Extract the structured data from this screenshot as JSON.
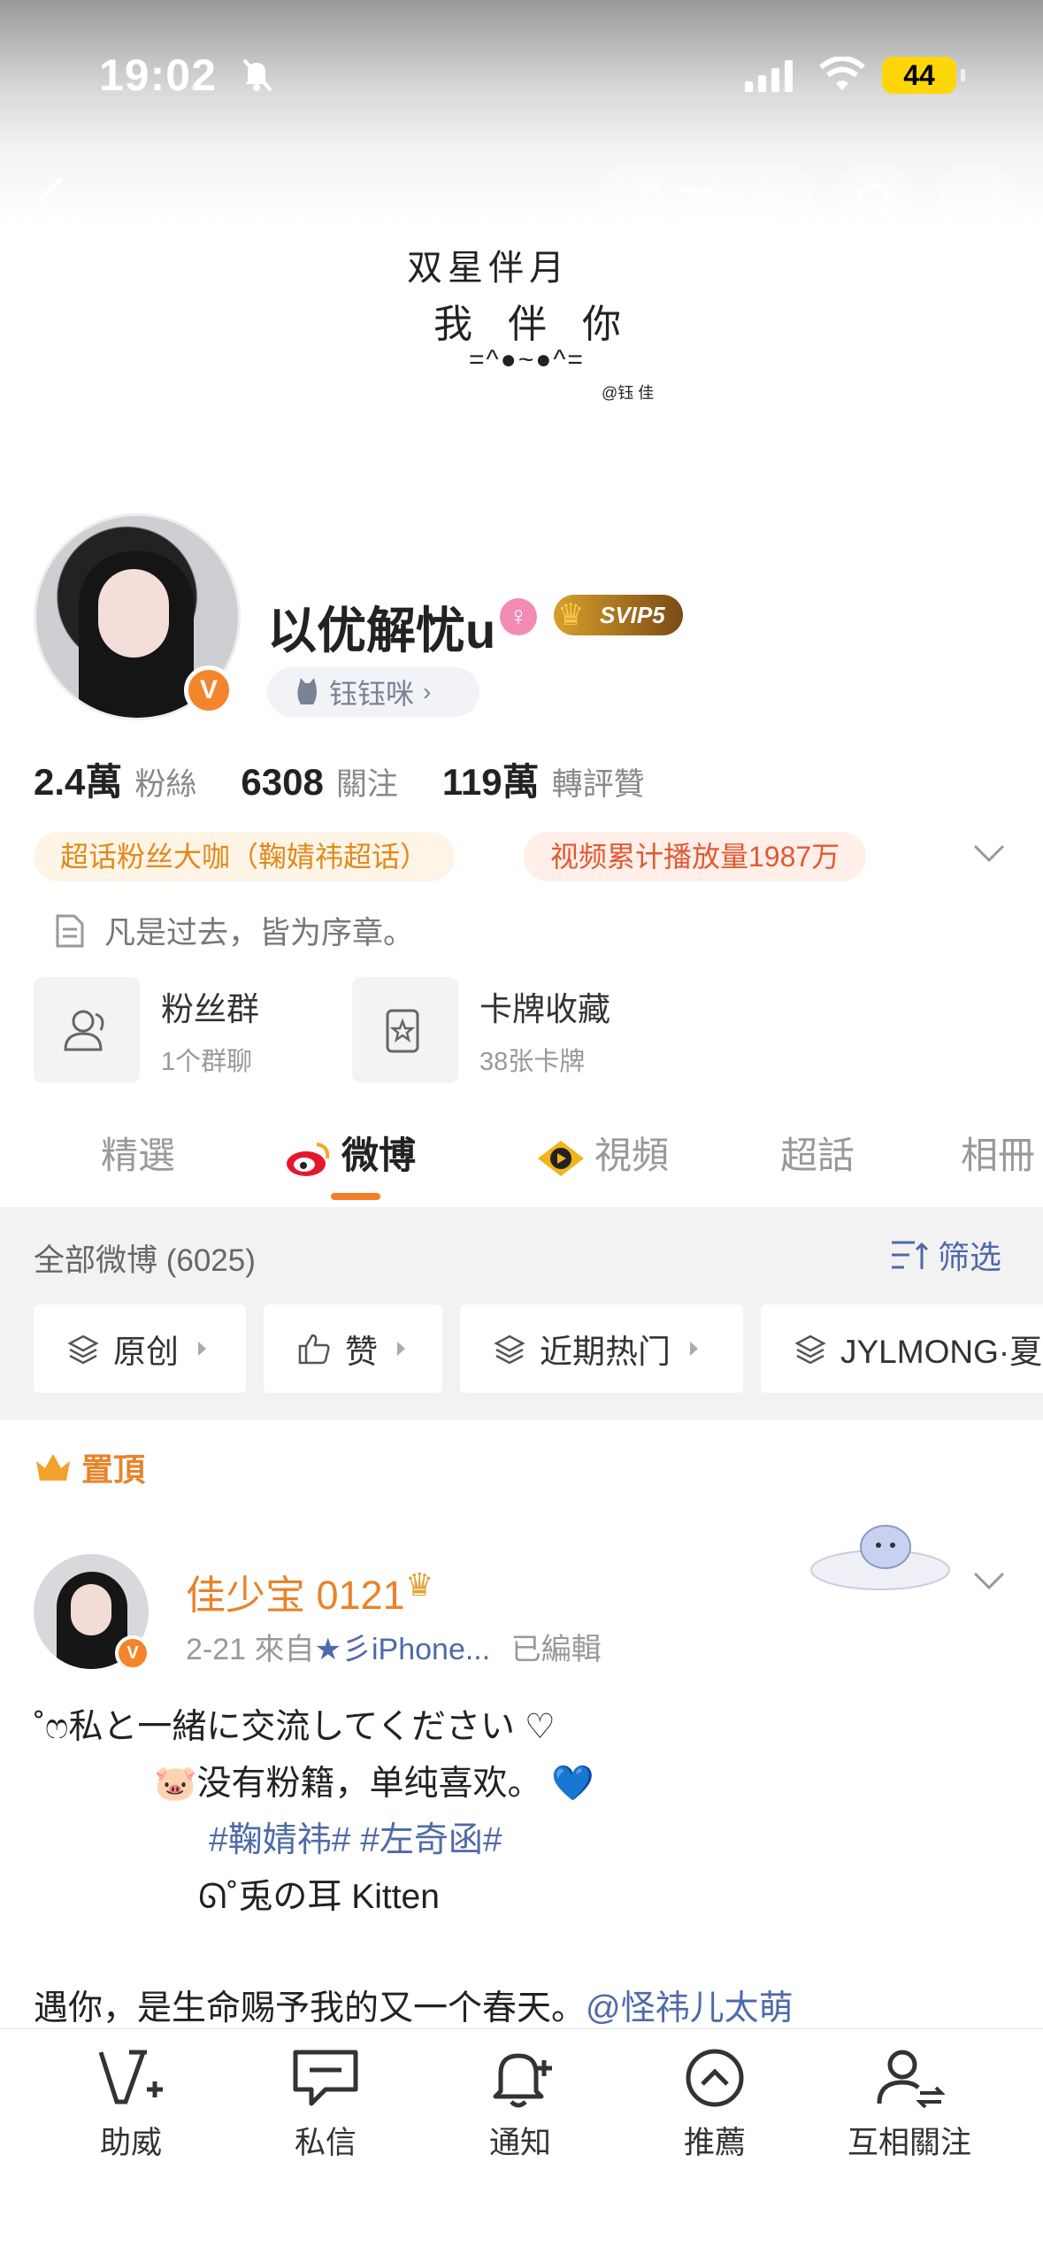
{
  "status_bar": {
    "time": "19:02",
    "battery": "44"
  },
  "header": {
    "like_button": "喜欢你"
  },
  "banner": {
    "line1": "双星伴月",
    "line2": "我伴你",
    "line3": "=^●~●^=",
    "credit": "@钰 佳"
  },
  "profile": {
    "name": "以优解忧u",
    "vip_label": "SVIP5",
    "tag": "钰钰咪",
    "verified_mark": "V",
    "stats": [
      {
        "value": "2.4萬",
        "label": "粉絲"
      },
      {
        "value": "6308",
        "label": "關注"
      },
      {
        "value": "119萬",
        "label": "轉評贊"
      }
    ],
    "chips": [
      "超话粉丝大咖（鞠婧祎超话）",
      "视频累计播放量1987万"
    ],
    "bio": "凡是过去，皆为序章。",
    "cards": [
      {
        "title": "粉丝群",
        "subtitle": "1个群聊"
      },
      {
        "title": "卡牌收藏",
        "subtitle": "38张卡牌"
      }
    ]
  },
  "tabs": [
    "精選",
    "微博",
    "視頻",
    "超話",
    "相冊"
  ],
  "feed": {
    "all_count": "全部微博 (6025)",
    "filter_label": "筛选",
    "pills": [
      "原创",
      "赞",
      "近期热门",
      "JYLMONG·夏"
    ]
  },
  "post": {
    "pinned_label": "置頂",
    "author": "佳少宝 0121",
    "date": "2-21",
    "source_prefix": "來自",
    "source": "★彡iPhone...",
    "edited": "已編輯",
    "line1": "˚ෆ私と一緒に交流してください ♡",
    "line2": "🐷没有粉籍，单纯喜欢。 💙",
    "line3": "#鞠婧祎# #左奇函#",
    "line4": "ᘏ˚兎の耳 Kitten",
    "line5_text": "遇你，是生命赐予我的又一个春天。",
    "line5_mention": "@怪祎儿太萌"
  },
  "bottom_nav": [
    {
      "label": "助威",
      "icon": "v-plus-icon"
    },
    {
      "label": "私信",
      "icon": "chat-icon"
    },
    {
      "label": "通知",
      "icon": "bell-plus-icon"
    },
    {
      "label": "推薦",
      "icon": "up-circle-icon"
    },
    {
      "label": "互相關注",
      "icon": "user-swap-icon"
    }
  ],
  "colors": {
    "accent": "#f57d2a",
    "link": "#4e6aa8",
    "pinned": "#e8832a"
  }
}
